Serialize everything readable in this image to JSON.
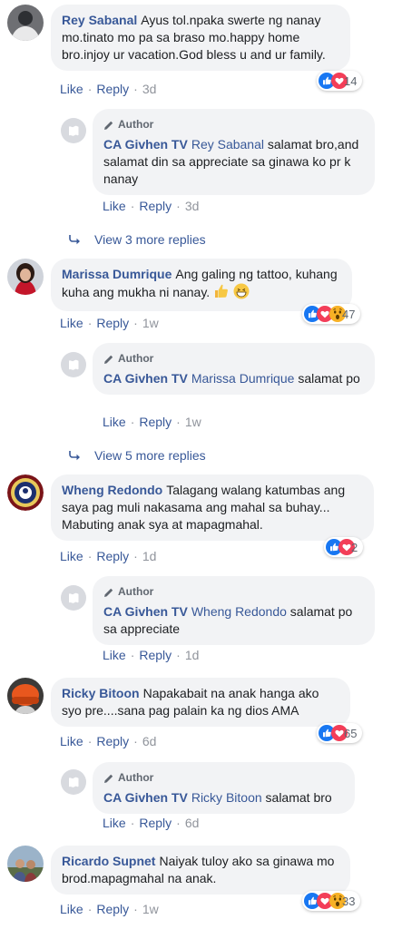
{
  "comments": [
    {
      "author": "Rey Sabanal",
      "text": "Ayus tol.npaka swerte ng nanay mo.tinato mo pa sa braso mo.happy home bro.injoy ur vacation.God bless u and ur family.",
      "like": "Like",
      "reply": "Reply",
      "time": "3d",
      "reaction_count": "14",
      "reactions": [
        "like-icon",
        "love-icon"
      ],
      "reply_item": {
        "badge": "Author",
        "author": "CA Givhen TV",
        "mention": "Rey Sabanal",
        "text": "salamat bro,and salamat din sa appreciate sa ginawa ko pr k nanay",
        "like": "Like",
        "reply": "Reply",
        "time": "3d"
      },
      "more_replies": "View 3 more replies"
    },
    {
      "author": "Marissa Dumrique",
      "text": "Ang galing ng tattoo, kuhang kuha ang mukha ni nanay.",
      "emojis": [
        "thumbs-up-emoji",
        "grin-emoji"
      ],
      "like": "Like",
      "reply": "Reply",
      "time": "1w",
      "reaction_count": "47",
      "reactions": [
        "like-icon",
        "love-icon",
        "wow-icon"
      ],
      "reply_item": {
        "badge": "Author",
        "author": "CA Givhen TV",
        "mention": "Marissa Dumrique",
        "text": "salamat po",
        "like": "Like",
        "reply": "Reply",
        "time": "1w"
      },
      "more_replies": "View 5 more replies"
    },
    {
      "author": "Wheng Redondo",
      "text": "Talagang walang katumbas ang saya pag muli nakasama ang mahal sa buhay... Mabuting anak sya at mapagmahal.",
      "like": "Like",
      "reply": "Reply",
      "time": "1d",
      "reaction_count": "2",
      "reactions": [
        "like-icon",
        "love-icon"
      ],
      "reply_item": {
        "badge": "Author",
        "author": "CA Givhen TV",
        "mention": "Wheng Redondo",
        "text": "salamat po sa appreciate",
        "like": "Like",
        "reply": "Reply",
        "time": "1d"
      }
    },
    {
      "author": "Ricky Bitoon",
      "text": "Napakabait na anak hanga ako syo pre....sana pag palain ka ng dios AMA",
      "like": "Like",
      "reply": "Reply",
      "time": "6d",
      "reaction_count": "65",
      "reactions": [
        "like-icon",
        "love-icon"
      ],
      "reply_item": {
        "badge": "Author",
        "author": "CA Givhen TV",
        "mention": "Ricky Bitoon",
        "text": "salamat bro",
        "like": "Like",
        "reply": "Reply",
        "time": "6d"
      }
    },
    {
      "author": "Ricardo Supnet",
      "text": "Naiyak tuloy ako sa ginawa mo brod.mapagmahal na anak.",
      "like": "Like",
      "reply": "Reply",
      "time": "1w",
      "reaction_count": "33",
      "reactions": [
        "like-icon",
        "love-icon",
        "wow-icon"
      ]
    }
  ],
  "colors": {
    "link": "#385898",
    "bubble": "#f2f3f5",
    "meta": "#90949c",
    "like": "#1877f2",
    "love": "#f33e58",
    "wow": "#f7b125"
  }
}
